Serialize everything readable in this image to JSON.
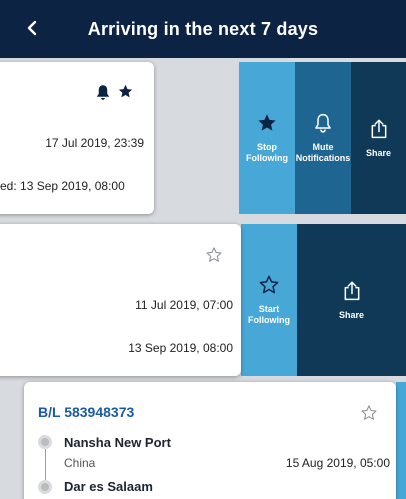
{
  "header": {
    "title": "Arriving in the next 7 days",
    "back_icon": "chevron-left-icon"
  },
  "card1": {
    "icons": [
      "bell-icon",
      "star-filled-icon"
    ],
    "departure": "17 Jul 2019, 23:39",
    "arrival": "ed: 13 Sep 2019, 08:00",
    "actions": [
      {
        "label": "Stop\nFollowing",
        "icon": "star-filled-icon",
        "color": "#47a8d8"
      },
      {
        "label": "Mute\nNotifications",
        "icon": "bell-outline-icon",
        "color": "#1f6592"
      },
      {
        "label": "Share",
        "icon": "share-icon",
        "color": "#0f3957"
      }
    ]
  },
  "card2": {
    "icons": [
      "star-outline-icon"
    ],
    "departure": "11 Jul 2019, 07:00",
    "arrival": "13 Sep 2019, 08:00",
    "actions": [
      {
        "label": "Start\nFollowing",
        "icon": "star-outline-icon",
        "color": "#47a8d8"
      },
      {
        "label": "Share",
        "icon": "share-icon",
        "color": "#0f3957"
      }
    ]
  },
  "card3": {
    "bl": "B/L  583948373",
    "icons": [
      "star-outline-icon"
    ],
    "origin_name": "Nansha New Port",
    "origin_country": "China",
    "origin_date": "15 Aug 2019, 05:00",
    "destination_name": "Dar es Salaam"
  }
}
